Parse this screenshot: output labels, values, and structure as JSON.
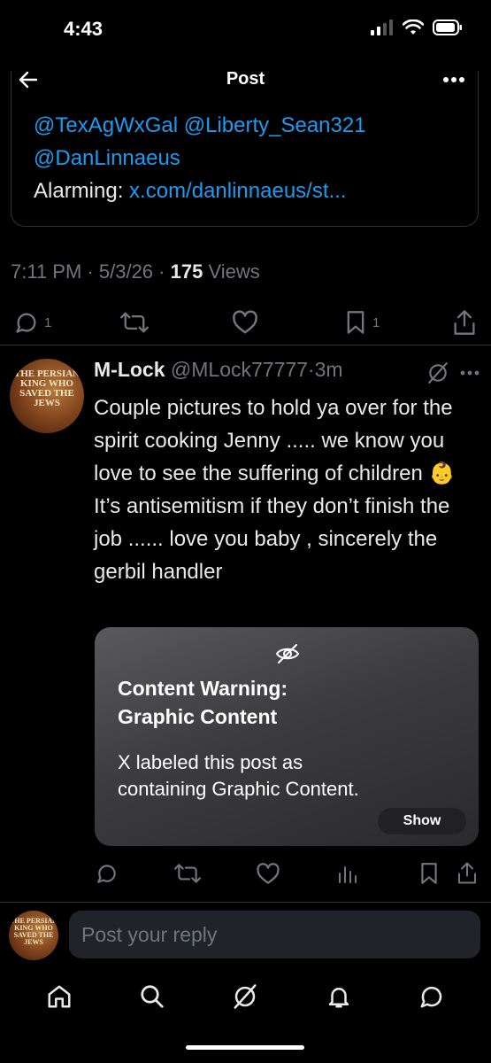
{
  "status_bar": {
    "time": "4:43"
  },
  "header": {
    "title": "Post"
  },
  "quoted": {
    "line1": "@TexAgWxGal @Liberty_Sean321",
    "line2": "@DanLinnaeus",
    "line3_prefix": "Alarming: ",
    "line3_link": "x.com/danlinnaeus/st..."
  },
  "post_meta": {
    "time": "7:11 PM",
    "sep1": " · ",
    "date": "5/3/26",
    "sep2": " · ",
    "views_count": "175",
    "views_label": " Views"
  },
  "post_actions": {
    "reply_count": "1",
    "bookmark_count": "1"
  },
  "reply": {
    "avatar_text": "THE PERSIAN KING WHO SAVED THE JEWS",
    "display_name": "M-Lock",
    "handle": "@MLock77777",
    "dot": "·",
    "time": "3m",
    "body_part1": "Couple pictures to hold ya over for the spirit cooking Jenny ..... we know you love to see the suffering of children ",
    "emoji": "👶",
    "body_part2": " It’s antisemitism if they don’t finish the job ...... love you baby , sincerely the gerbil handler"
  },
  "content_warning": {
    "title_line1": "Content Warning:",
    "title_line2": "Graphic Content",
    "body_line1": "X labeled this post as",
    "body_line2": "containing Graphic Content.",
    "show_label": "Show"
  },
  "reply_box": {
    "placeholder": "Post your reply",
    "avatar_text": "THE PERSIAN KING WHO SAVED THE JEWS"
  },
  "colors": {
    "accent": "#1d9bf0",
    "background": "#000000",
    "secondary_text": "#71767b"
  }
}
